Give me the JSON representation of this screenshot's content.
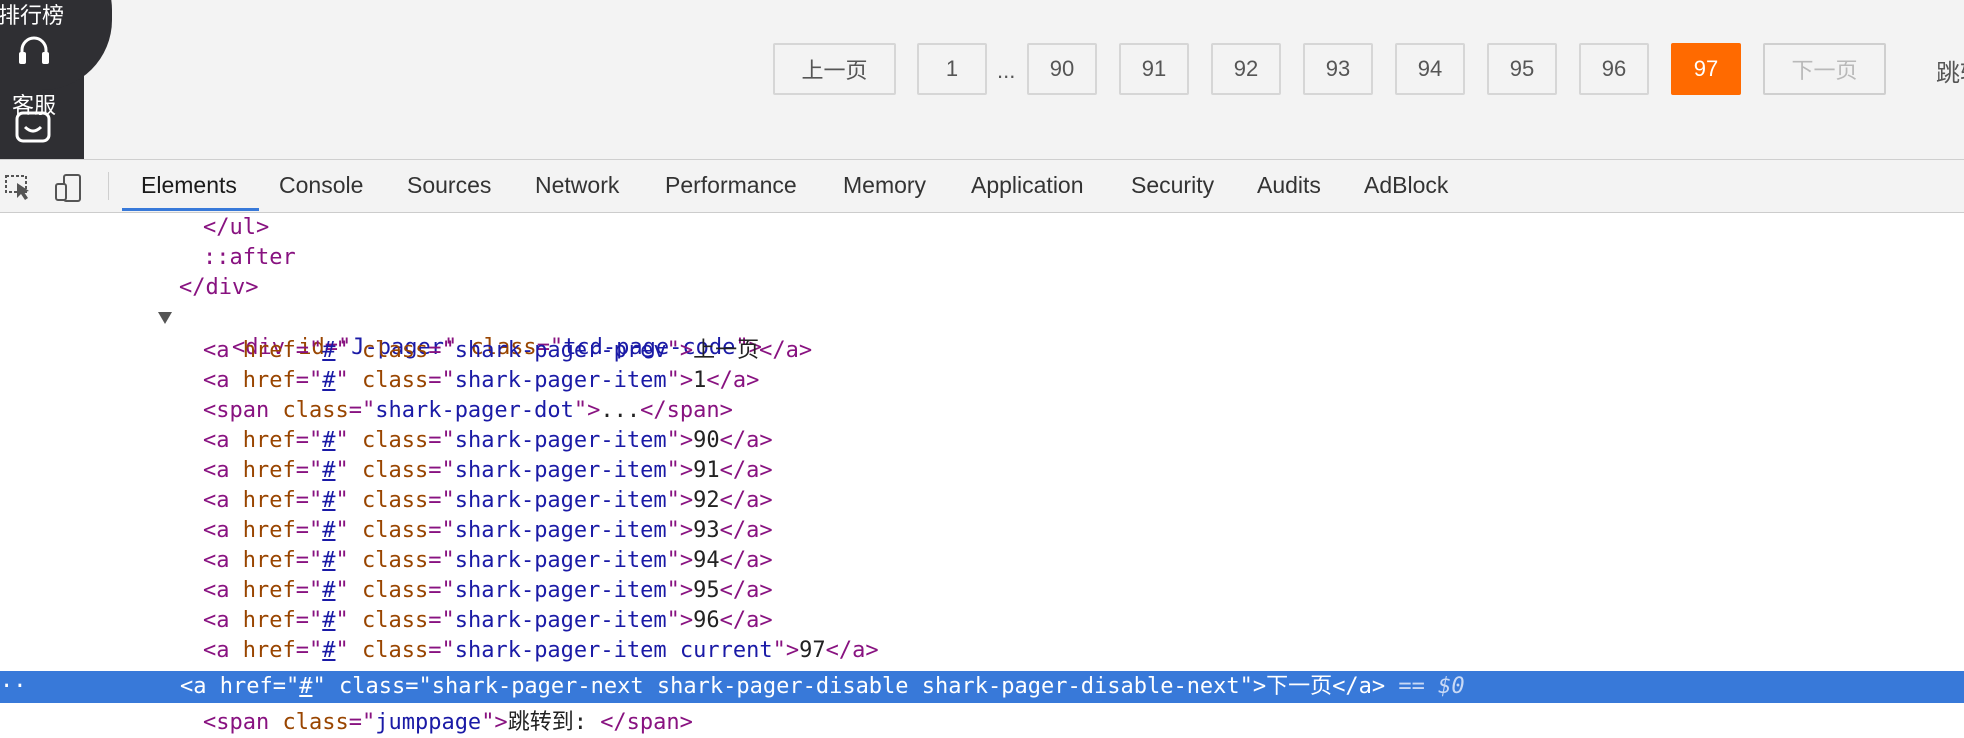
{
  "sidepanel": {
    "rank_label": "排行榜",
    "service_label": "客服",
    "headset_icon": "headset-icon",
    "robot_icon": "robot-icon"
  },
  "pager": {
    "prev": "上一页",
    "first": "1",
    "dots": "...",
    "pages": [
      "90",
      "91",
      "92",
      "93",
      "94",
      "95",
      "96"
    ],
    "current": "97",
    "next": "下一页",
    "jump": "跳转"
  },
  "devtools": {
    "inspect_icon": "inspect-element-icon",
    "device_icon": "device-toolbar-icon",
    "tabs": [
      "Elements",
      "Console",
      "Sources",
      "Network",
      "Performance",
      "Memory",
      "Application",
      "Security",
      "Audits",
      "AdBlock"
    ],
    "active_tab": "Elements"
  },
  "dom": {
    "ul_close": "</ul>",
    "after": "::after",
    "div_close": "</div>",
    "pager_div": {
      "tag": "div",
      "id": "J-pager",
      "class": "tcd-page-code"
    },
    "prev_link": {
      "href": "#",
      "class": "shark-pager-prev",
      "text": "上一页"
    },
    "first_link": {
      "href": "#",
      "class": "shark-pager-item",
      "text": "1"
    },
    "dot_span": {
      "class": "shark-pager-dot",
      "text": "..."
    },
    "items": [
      {
        "href": "#",
        "class": "shark-pager-item",
        "text": "90"
      },
      {
        "href": "#",
        "class": "shark-pager-item",
        "text": "91"
      },
      {
        "href": "#",
        "class": "shark-pager-item",
        "text": "92"
      },
      {
        "href": "#",
        "class": "shark-pager-item",
        "text": "93"
      },
      {
        "href": "#",
        "class": "shark-pager-item",
        "text": "94"
      },
      {
        "href": "#",
        "class": "shark-pager-item",
        "text": "95"
      },
      {
        "href": "#",
        "class": "shark-pager-item",
        "text": "96"
      }
    ],
    "current_link": {
      "href": "#",
      "class": "shark-pager-item current",
      "text": "97"
    },
    "next_link": {
      "href": "#",
      "class": "shark-pager-next shark-pager-disable shark-pager-disable-next",
      "text": "下一页",
      "hint": "== $0"
    },
    "jump_span": {
      "class": "jumppage",
      "text": "跳转到: "
    }
  },
  "colors": {
    "accent": "#ff6a00",
    "selection": "#3879d9",
    "tag": "#881280",
    "attr": "#994500",
    "value": "#1a1aa6"
  }
}
